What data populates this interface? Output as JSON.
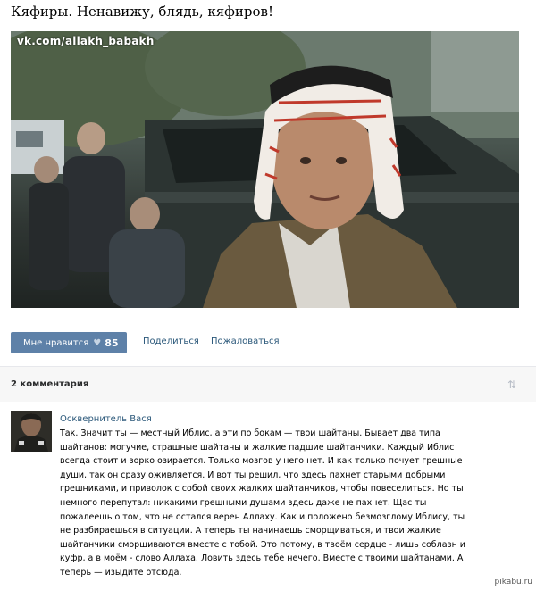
{
  "post": {
    "title": "Кяфиры. Ненавижу, блядь, кяфиров!",
    "image_watermark": "vk.com/allakh_babakh"
  },
  "actions": {
    "like_label": "Мне нравится",
    "like_count": "85",
    "share_label": "Поделиться",
    "report_label": "Пожаловаться"
  },
  "comments": {
    "count_label": "2 комментария",
    "items": [
      {
        "author": "Осквернитель Вася",
        "text": "Так. Значит ты — местный Иблис, а эти по бокам — твои шайтаны. Бывает два типа шайтанов: могучие, страшные шайтаны и жалкие падшие шайтанчики. Каждый Иблис всегда стоит и зорко озирается. Только мозгов у него нет. И как только почует грешные души, так он сразу оживляется. И вот ты решил, что здесь пахнет старыми добрыми грешниками, и приволок с собой своих жалких шайтанчиков, чтобы повеселиться. Но ты немного перепутал: никакими грешными душами здесь даже не пахнет. Щас ты пожалеешь о том, что не остался верен Аллаху. Как и положено безмозглому Иблису, ты не разбираешься в ситуации. А теперь ты начинаешь сморщиваться, и твои жалкие шайтанчики сморщиваются вместе с тобой. Это потому, в твоём сердце - лишь соблазн и куфр, а в моём - слово Аллаха. Ловить здесь тебе нечего. Вместе с твоими шайтанами. А теперь — изыдите отсюда."
      }
    ]
  },
  "footer": {
    "site_mark": "pikabu.ru"
  },
  "icons": {
    "heart": "heart-icon",
    "sort": "sort-arrows-icon"
  },
  "colors": {
    "like_button": "#5e81a8",
    "link": "#2b587a",
    "comments_bar": "#f7f7f7"
  }
}
